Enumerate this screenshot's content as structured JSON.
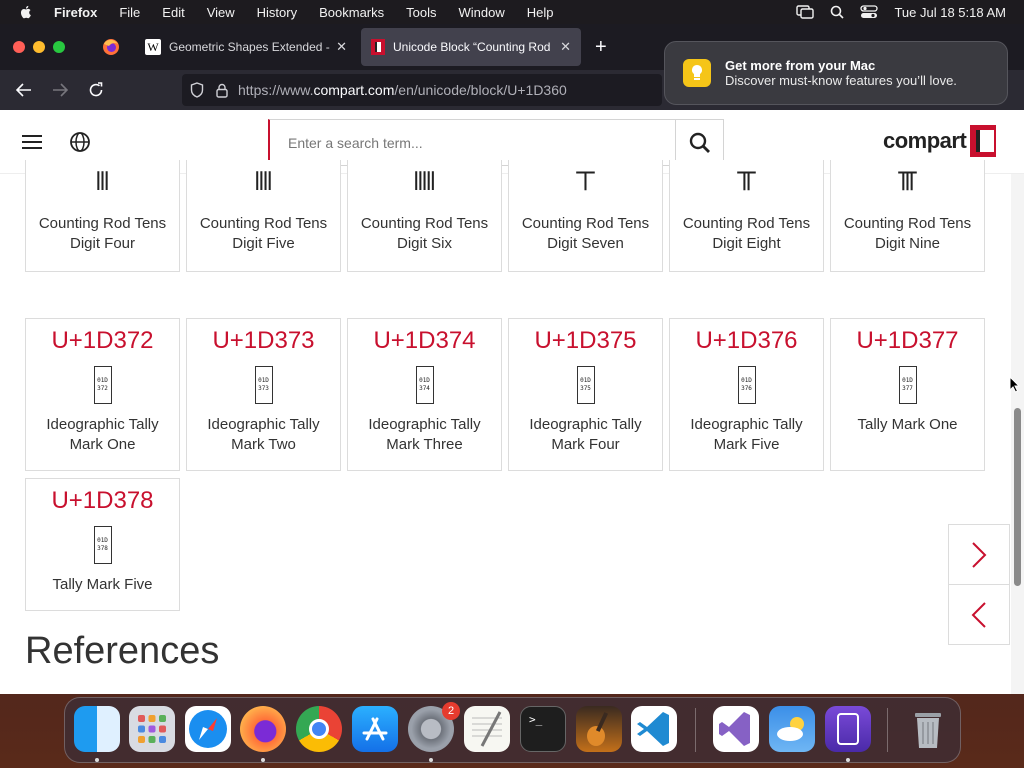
{
  "menubar": {
    "app_name": "Firefox",
    "items": [
      "File",
      "Edit",
      "View",
      "History",
      "Bookmarks",
      "Tools",
      "Window",
      "Help"
    ],
    "datetime": "Tue Jul 18  5:18 AM"
  },
  "browser": {
    "tabs": [
      {
        "title": "Geometric Shapes Extended - W",
        "favicon": "wikipedia-icon"
      },
      {
        "title": "Unicode Block “Counting Rod N",
        "favicon": "compart-icon"
      }
    ],
    "url_prefix": "https://www.",
    "url_domain": "compart.com",
    "url_path": "/en/unicode/block/U+1D360"
  },
  "notification": {
    "title": "Get more from your Mac",
    "body": "Discover must-know features you’ll love."
  },
  "site": {
    "search_placeholder": "Enter a search term...",
    "logo_text": "compart"
  },
  "cards_top": [
    {
      "glyph": "𝍫",
      "name_line1": "Counting Rod Tens",
      "name_line2": "Digit Four"
    },
    {
      "glyph": "𝍬",
      "name_line1": "Counting Rod Tens",
      "name_line2": "Digit Five"
    },
    {
      "glyph": "𝍭",
      "name_line1": "Counting Rod Tens",
      "name_line2": "Digit Six"
    },
    {
      "glyph": "𝍮",
      "name_line1": "Counting Rod Tens",
      "name_line2": "Digit Seven"
    },
    {
      "glyph": "𝍯",
      "name_line1": "Counting Rod Tens",
      "name_line2": "Digit Eight"
    },
    {
      "glyph": "𝍰",
      "name_line1": "Counting Rod Tens",
      "name_line2": "Digit Nine"
    }
  ],
  "cards_mid": [
    {
      "code": "U+1D372",
      "hex_top": "01D",
      "hex_bottom": "372",
      "name_line1": "Ideographic Tally",
      "name_line2": "Mark One"
    },
    {
      "code": "U+1D373",
      "hex_top": "01D",
      "hex_bottom": "373",
      "name_line1": "Ideographic Tally",
      "name_line2": "Mark Two"
    },
    {
      "code": "U+1D374",
      "hex_top": "01D",
      "hex_bottom": "374",
      "name_line1": "Ideographic Tally",
      "name_line2": "Mark Three"
    },
    {
      "code": "U+1D375",
      "hex_top": "01D",
      "hex_bottom": "375",
      "name_line1": "Ideographic Tally",
      "name_line2": "Mark Four"
    },
    {
      "code": "U+1D376",
      "hex_top": "01D",
      "hex_bottom": "376",
      "name_line1": "Ideographic Tally",
      "name_line2": "Mark Five"
    },
    {
      "code": "U+1D377",
      "hex_top": "01D",
      "hex_bottom": "377",
      "name_line1": "Tally Mark One",
      "name_line2": ""
    }
  ],
  "cards_bottom": [
    {
      "code": "U+1D378",
      "hex_top": "01D",
      "hex_bottom": "378",
      "name_line1": "Tally Mark Five",
      "name_line2": ""
    }
  ],
  "references_heading": "References",
  "dock": {
    "settings_badge": "2",
    "apps": [
      "Finder",
      "Launchpad",
      "Safari",
      "Firefox",
      "Chrome",
      "App Store",
      "System Settings",
      "TextEdit",
      "Terminal",
      "GarageBand",
      "Visual Studio Code",
      "Visual Studio",
      "Weather",
      "Simulator",
      "Trash"
    ]
  },
  "colors": {
    "accent_red": "#c8102e",
    "tab_bar": "#1c1b22",
    "nav_bar": "#2b2a33"
  }
}
